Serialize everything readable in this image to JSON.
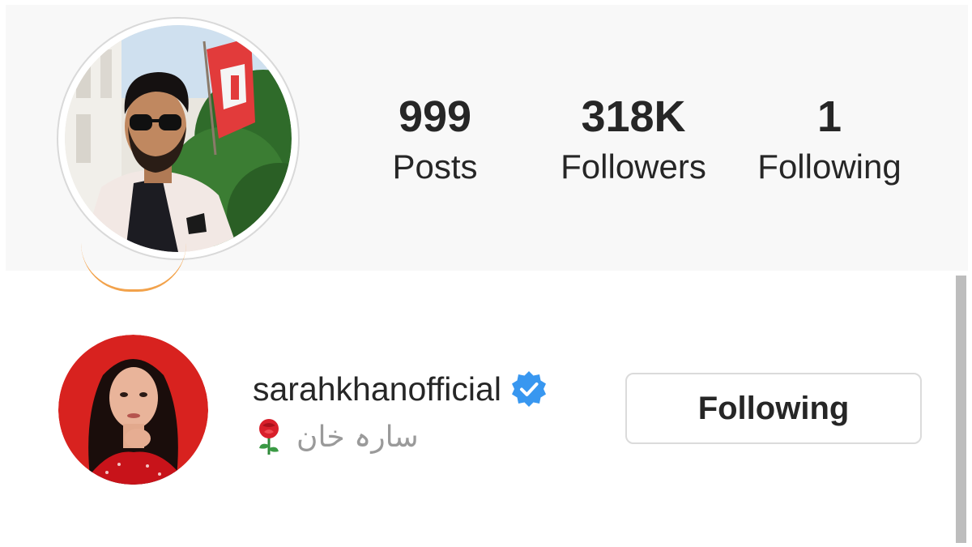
{
  "profile": {
    "stats": [
      {
        "value": "999",
        "label": "Posts"
      },
      {
        "value": "318K",
        "label": "Followers"
      },
      {
        "value": "1",
        "label": "Following"
      }
    ]
  },
  "follow_list": {
    "items": [
      {
        "username": "sarahkhanofficial",
        "verified": true,
        "bio_text": "سارہ خان",
        "bio_icon": "rose-icon",
        "button_label": "Following"
      }
    ]
  },
  "colors": {
    "panel_bg": "#f8f8f8",
    "text": "#262626",
    "secondary_text": "#9a9a9a",
    "verified_blue": "#3897f0",
    "button_border": "#dbdbdb",
    "story_ring": "#f2a24b"
  }
}
